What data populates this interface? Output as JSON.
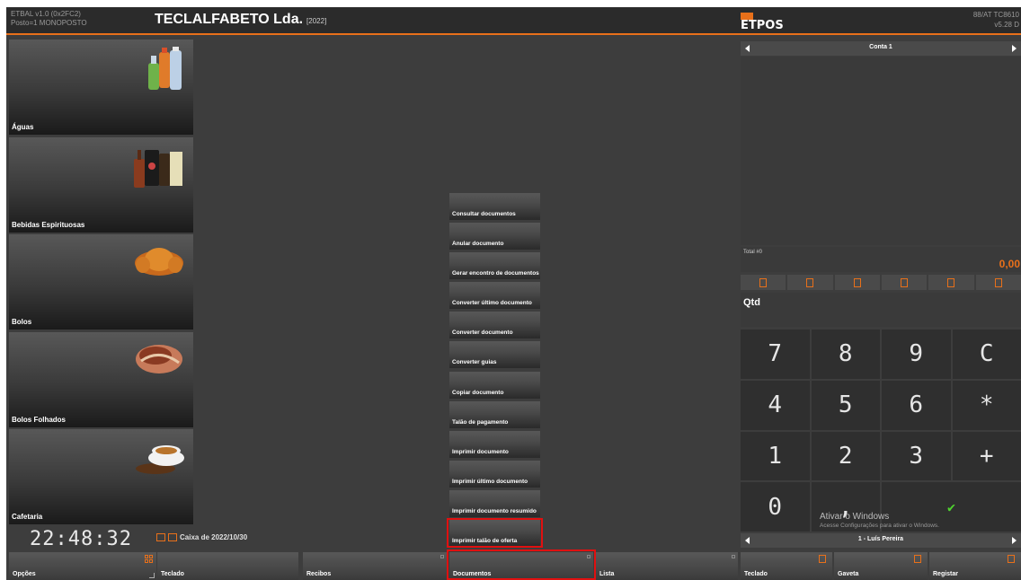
{
  "header": {
    "app_version": "ETBAL v1.0 (0x2FC2)",
    "posto": "Posto=1 MONOPOSTO",
    "company": "TECLALFABETO Lda.",
    "year": "[2022]",
    "logo_text": "ETPOS",
    "cert": "88/AT TC8610",
    "version": "v5.28 D"
  },
  "categories": [
    {
      "label": "Águas",
      "icon": "water-bottles"
    },
    {
      "label": "Bebidas Espirituosas",
      "icon": "liquor-bottles"
    },
    {
      "label": "Bolos",
      "icon": "croissant"
    },
    {
      "label": "Bolos Folhados",
      "icon": "pastry"
    },
    {
      "label": "Cafetaria",
      "icon": "coffee-cup"
    }
  ],
  "clock": "22:48:32",
  "caixa": "Caixa de 2022/10/30",
  "document_menu": [
    "Consultar documentos",
    "Anular documento",
    "Gerar encontro de documentos",
    "Converter último documento",
    "Converter documento",
    "Converter guias",
    "Copiar documento",
    "Talão de pagamento",
    "Imprimir documento",
    "Imprimir último documento",
    "Imprimir documento resumido",
    "Imprimir talão de oferta"
  ],
  "bottom_bar": {
    "opcoes": "Opções",
    "teclado": "Teclado",
    "recibos": "Recibos",
    "documentos": "Documentos",
    "lista": "Lista",
    "teclado_right": "Teclado",
    "gaveta": "Gaveta",
    "registar": "Registar"
  },
  "right_panel": {
    "conta": "Conta 1",
    "total_label": "Total #0",
    "total_value": "0,00",
    "qtd_label": "Qtd",
    "user": "1 - Luís Pereira",
    "keys": [
      "7",
      "8",
      "9",
      "C",
      "4",
      "5",
      "6",
      "*",
      "1",
      "2",
      "3",
      "+",
      "0",
      ",",
      "✔"
    ]
  },
  "watermark": {
    "line1": "Ativar o Windows",
    "line2": "Acesse Configurações para ativar o Windows."
  },
  "colors": {
    "accent": "#e8701a",
    "background": "#3d3d3d",
    "highlight": "#e01010",
    "ok": "#4fd32f"
  }
}
